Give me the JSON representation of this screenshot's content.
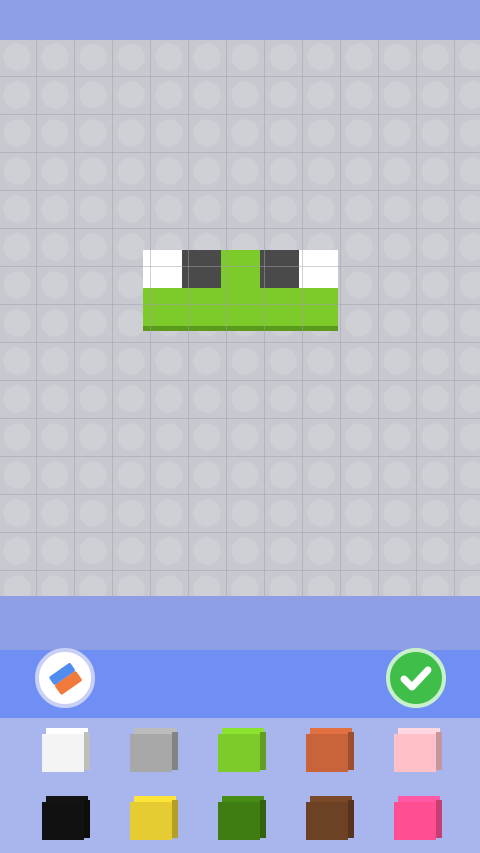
{
  "colors": {
    "header": "#8e9fe6",
    "toolbar": "#6f8ff5",
    "palette_bg": "#a9b6ee",
    "board": "#dcdce2"
  },
  "figure": {
    "pixels": [
      {
        "color": "#ffffff"
      },
      {
        "color": "#4a4a4a"
      },
      {
        "color": "#7ccb2b"
      },
      {
        "color": "#4a4a4a"
      },
      {
        "color": "#ffffff"
      },
      {
        "color": "#7ccb2b"
      },
      {
        "color": "#7ccb2b"
      },
      {
        "color": "#7ccb2b"
      },
      {
        "color": "#7ccb2b"
      },
      {
        "color": "#7ccb2b"
      }
    ]
  },
  "tools": {
    "eraser_icon": "eraser-icon",
    "confirm_icon": "checkmark-icon"
  },
  "palette": [
    {
      "name": "white",
      "color": "#f4f4f4"
    },
    {
      "name": "gray",
      "color": "#a8a8a8"
    },
    {
      "name": "light-green",
      "color": "#7ccb2b"
    },
    {
      "name": "orange-brown",
      "color": "#c9643a"
    },
    {
      "name": "pink",
      "color": "#ffc0c8"
    },
    {
      "name": "black",
      "color": "#111111"
    },
    {
      "name": "yellow",
      "color": "#e6cc33"
    },
    {
      "name": "dark-green",
      "color": "#3f7d12"
    },
    {
      "name": "brown",
      "color": "#6d4124"
    },
    {
      "name": "hot-pink",
      "color": "#ff4f92"
    }
  ]
}
